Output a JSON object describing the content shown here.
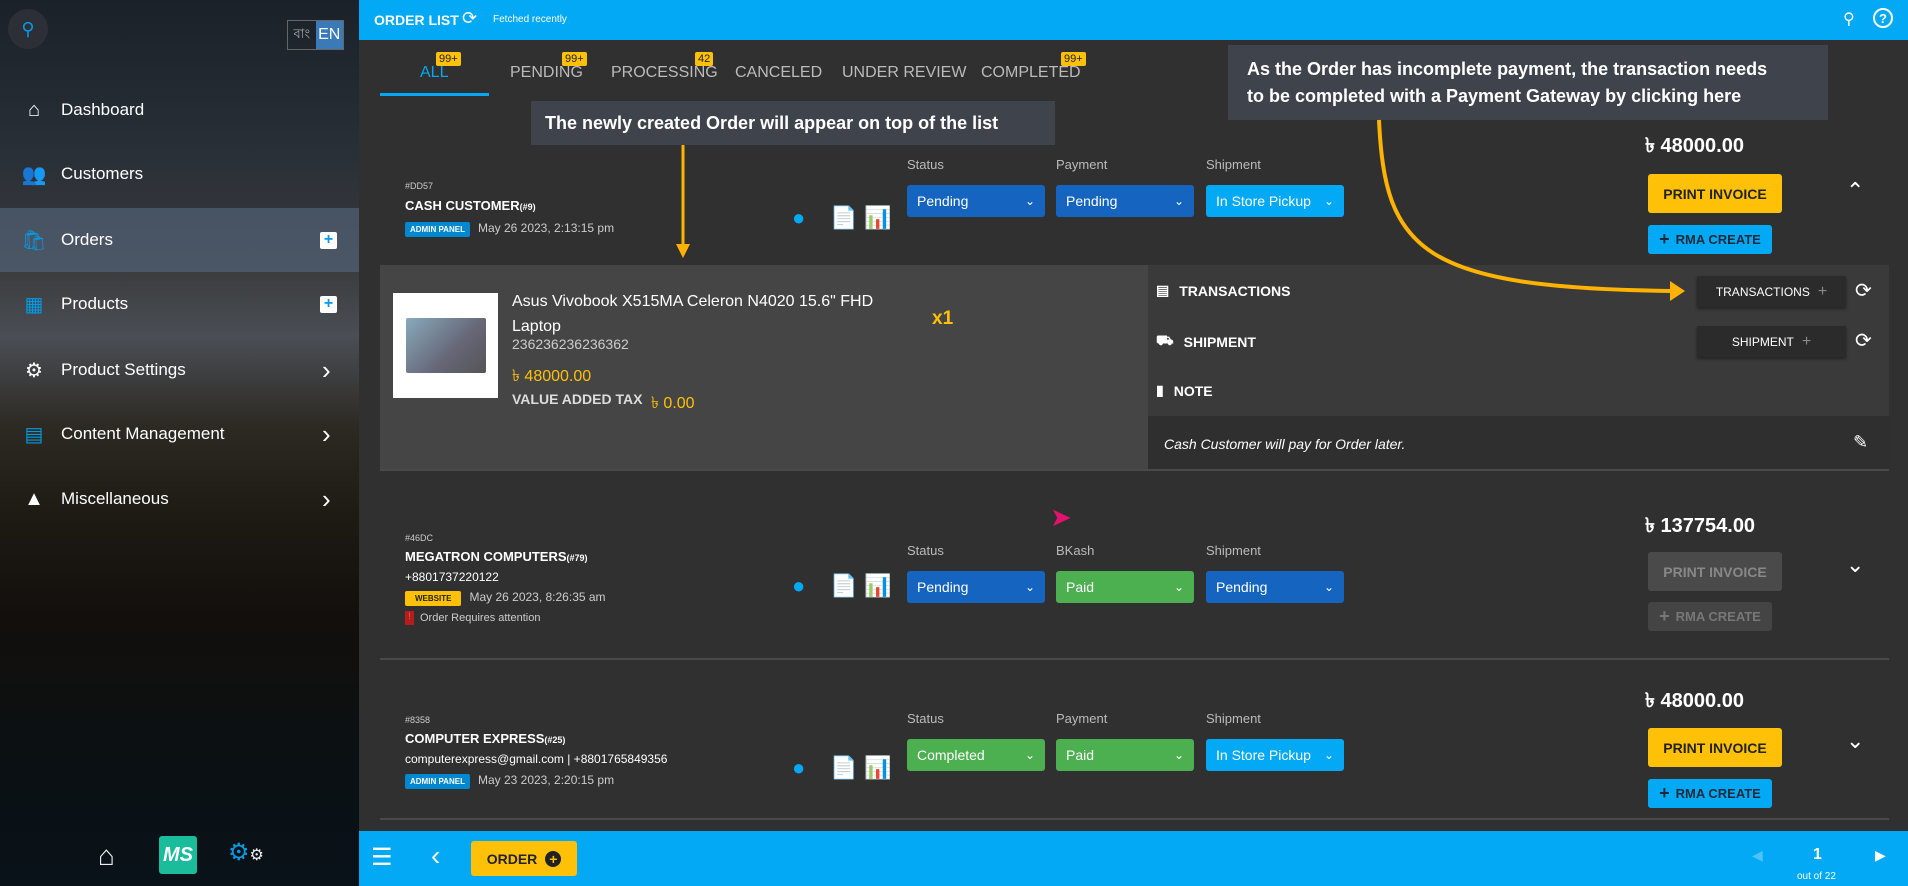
{
  "sidebar": {
    "lang": [
      "বাং",
      "EN"
    ],
    "items": [
      {
        "label": "Dashboard",
        "icon": "home-icon"
      },
      {
        "label": "Customers",
        "icon": "customers-icon"
      },
      {
        "label": "Orders",
        "icon": "orders-icon",
        "active": true,
        "add": true
      },
      {
        "label": "Products",
        "icon": "products-icon",
        "add": true
      },
      {
        "label": "Product Settings",
        "icon": "gear-icon",
        "submenu": true
      },
      {
        "label": "Content Management",
        "icon": "content-icon",
        "submenu": true
      },
      {
        "label": "Miscellaneous",
        "icon": "shapes-icon",
        "submenu": true
      }
    ],
    "bottom_logo": "MS"
  },
  "header": {
    "title": "ORDER LIST",
    "fetch_status": "Fetched recently"
  },
  "tabs": [
    {
      "label": "ALL",
      "count": "99+",
      "active": true
    },
    {
      "label": "PENDING",
      "count": "99+"
    },
    {
      "label": "PROCESSING",
      "count": "42"
    },
    {
      "label": "CANCELED"
    },
    {
      "label": "UNDER REVIEW"
    },
    {
      "label": "COMPLETED",
      "count": "99+"
    }
  ],
  "annotations": {
    "top": "The newly created Order will appear on top of the list",
    "payment": [
      "As the Order has incomplete payment, the transaction needs",
      "to be completed with a Payment Gateway by clicking here"
    ]
  },
  "labels": {
    "status": "Status",
    "payment": "Payment",
    "shipment": "Shipment",
    "print": "PRINT INVOICE",
    "rma": "RMA CREATE"
  },
  "orders": [
    {
      "id": "#DD57",
      "name": "CASH CUSTOMER",
      "cust_no": "(#9)",
      "source": "ADMIN PANEL",
      "date": "May 26 2023, 2:13:15 pm",
      "payment_label": "Payment",
      "status": "Pending",
      "payment": "Pending",
      "shipment": "In Store Pickup",
      "total": "৳ 48000.00"
    },
    {
      "id": "#46DC",
      "name": "MEGATRON COMPUTERS",
      "cust_no": "(#79)",
      "contact": "+8801737220122",
      "source": "WEBSITE",
      "date": "May 26 2023, 8:26:35 am",
      "attention": "Order Requires attention",
      "payment_label": "BKash",
      "status": "Pending",
      "payment": "Paid",
      "shipment": "Pending",
      "total": "৳ 137754.00"
    },
    {
      "id": "#8358",
      "name": "COMPUTER EXPRESS",
      "cust_no": "(#25)",
      "contact": "computerexpress@gmail.com | +8801765849356",
      "source": "ADMIN PANEL",
      "date": "May 23 2023, 2:20:15 pm",
      "payment_label": "Payment",
      "status": "Completed",
      "payment": "Paid",
      "shipment": "In Store Pickup",
      "total": "৳ 48000.00"
    }
  ],
  "expanded": {
    "product": "Asus Vivobook X515MA Celeron N4020 15.6\" FHD",
    "product2": "Laptop",
    "sku": "236236236236362",
    "price": "৳ 48000.00",
    "qty": "x1",
    "vat_label": "VALUE ADDED TAX",
    "vat": "৳ 0.00",
    "transactions": "TRANSACTIONS",
    "shipment": "SHIPMENT",
    "note": "NOTE",
    "note_text": "Cash Customer will pay for Order later."
  },
  "footer": {
    "order_button": "ORDER",
    "page": "1",
    "page_total": "out of 22"
  },
  "colors": {
    "accent": "#03a9f4",
    "yellow": "#ffc107",
    "blue": "#1565c0",
    "green": "#4caf50"
  }
}
